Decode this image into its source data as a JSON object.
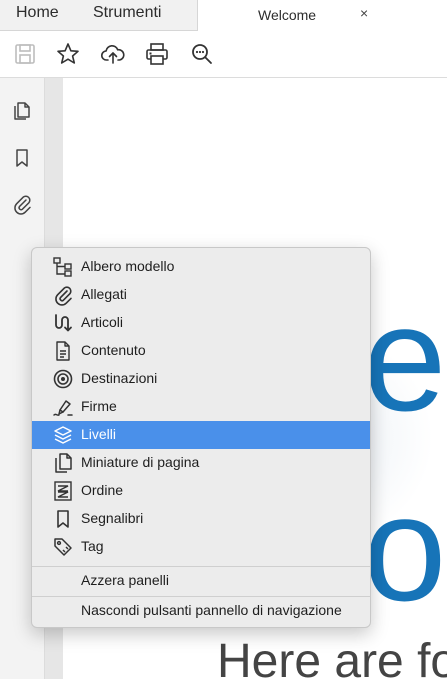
{
  "tabs": {
    "home": "Home",
    "tools": "Strumenti",
    "document": "Welcome",
    "close": "×"
  },
  "toolbar": {
    "icons": [
      "save-icon",
      "star-icon",
      "cloud-upload-icon",
      "print-icon",
      "zoom-icon"
    ]
  },
  "rail": {
    "icons": [
      "pages-icon",
      "bookmark-icon",
      "attachment-icon"
    ]
  },
  "document": {
    "big_text_1": "el",
    "big_text_2": "oc",
    "subtitle": "Here are fo"
  },
  "menu": {
    "items": [
      {
        "label": "Albero modello",
        "icon": "tree-icon"
      },
      {
        "label": "Allegati",
        "icon": "paperclip-icon"
      },
      {
        "label": "Articoli",
        "icon": "articles-icon"
      },
      {
        "label": "Contenuto",
        "icon": "content-icon"
      },
      {
        "label": "Destinazioni",
        "icon": "target-icon"
      },
      {
        "label": "Firme",
        "icon": "signature-icon"
      },
      {
        "label": "Livelli",
        "icon": "layers-icon",
        "selected": true
      },
      {
        "label": "Miniature di pagina",
        "icon": "thumbnails-icon"
      },
      {
        "label": "Ordine",
        "icon": "order-icon"
      },
      {
        "label": "Segnalibri",
        "icon": "bookmark-icon"
      },
      {
        "label": "Tag",
        "icon": "tag-icon"
      }
    ],
    "reset_label": "Azzera panelli",
    "hide_label": "Nascondi pulsanti pannello di navigazione"
  },
  "colors": {
    "selection": "#4a90ea",
    "doc_blue": "#1774b8"
  }
}
